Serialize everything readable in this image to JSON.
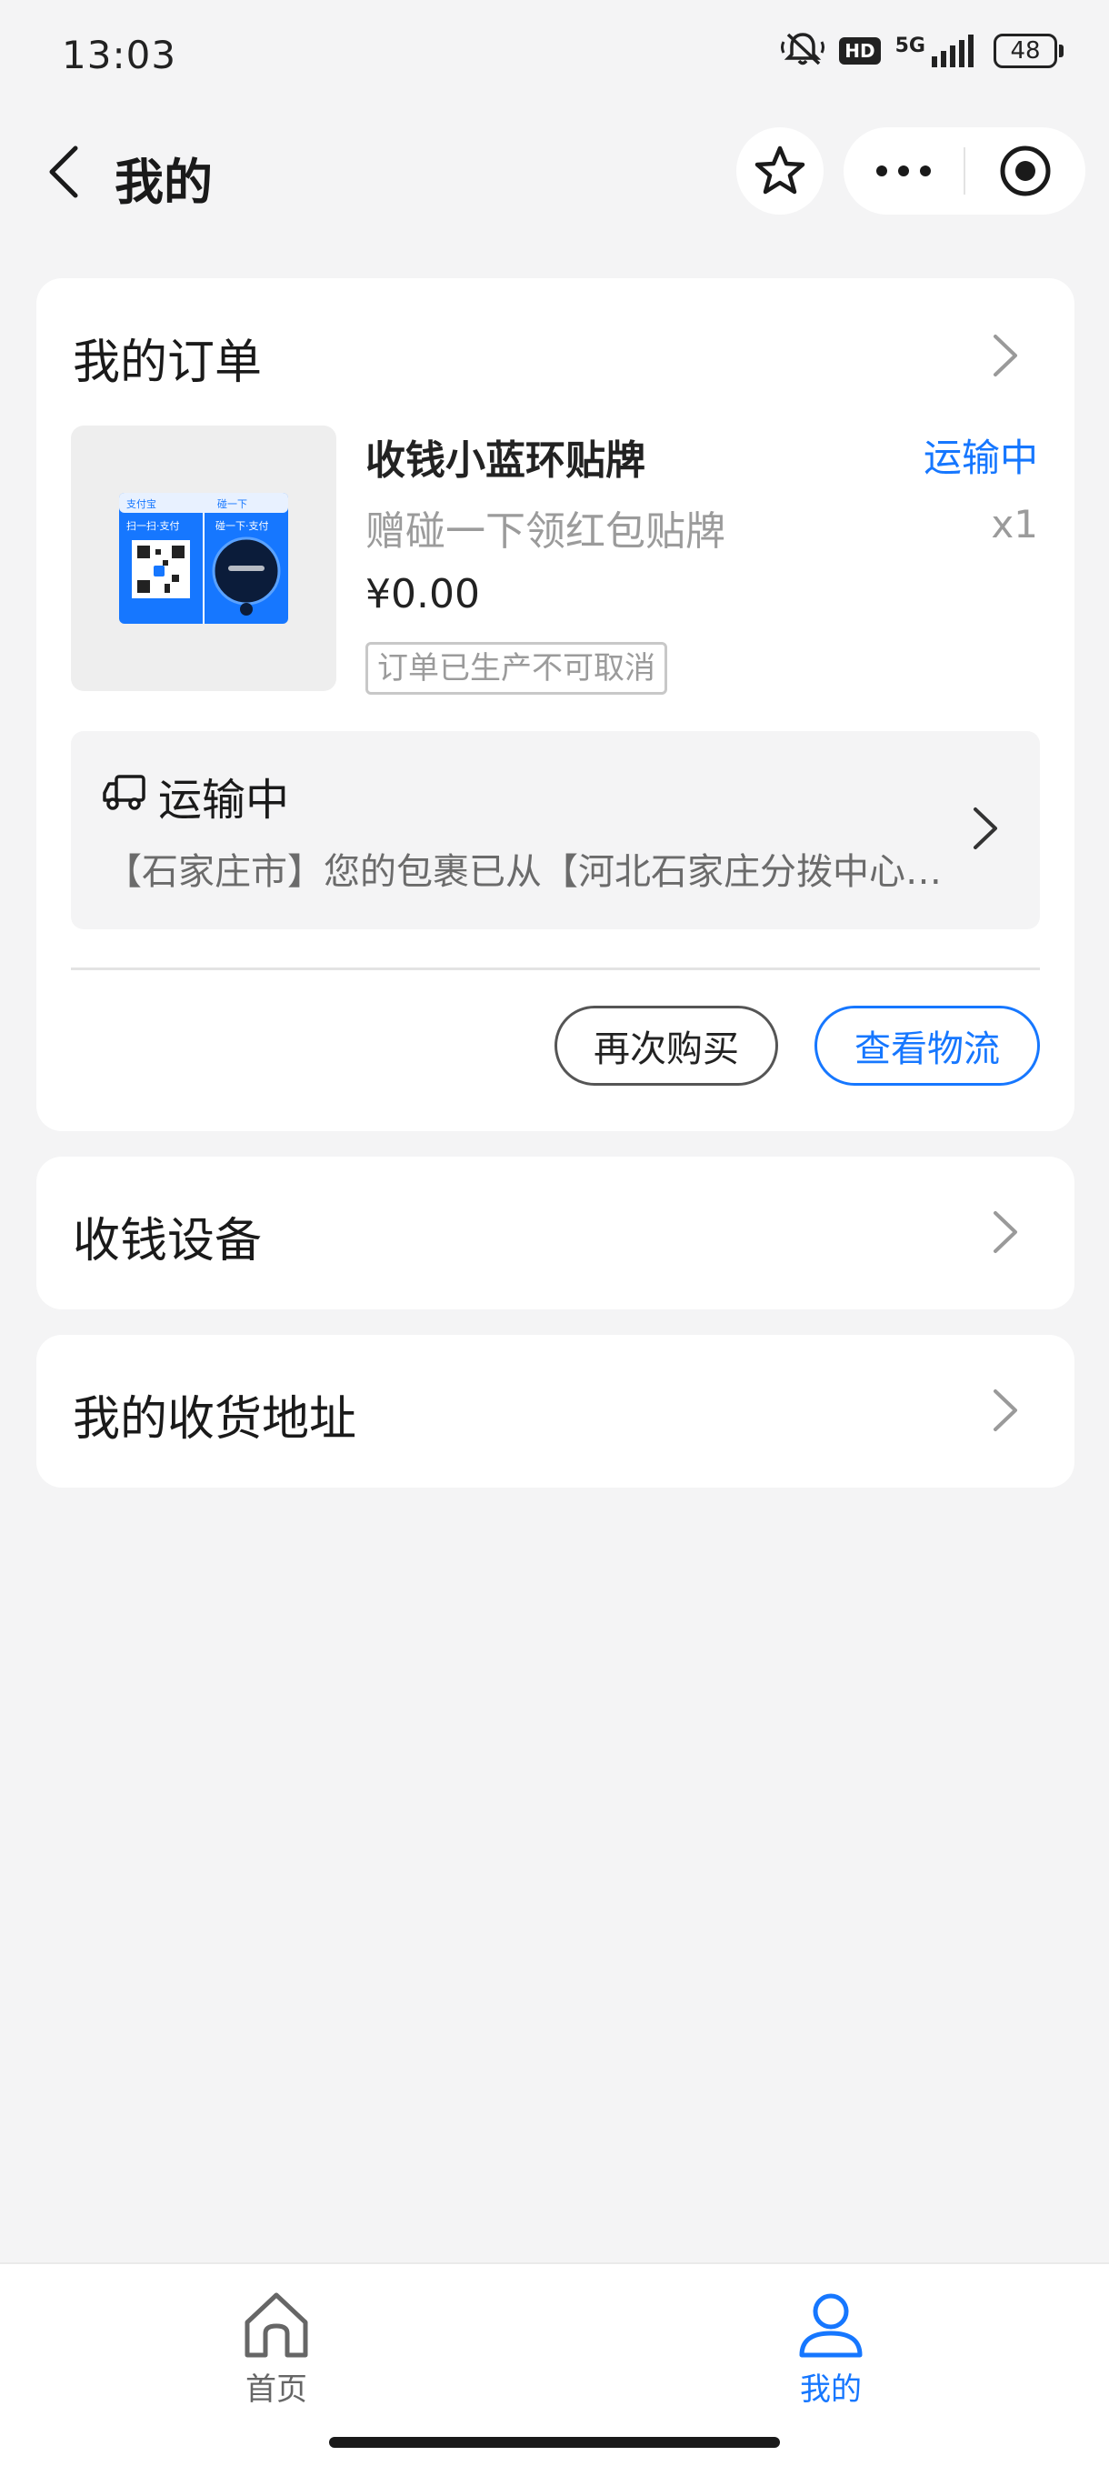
{
  "status_bar": {
    "time": "13:03",
    "hd": "HD",
    "network": "5G",
    "battery": "48",
    "icons": [
      "mute-icon",
      "signal-icon",
      "battery-icon"
    ]
  },
  "nav": {
    "title": "我的",
    "icons": [
      "back-icon",
      "star-icon",
      "more-icon",
      "close-target-icon"
    ]
  },
  "orders": {
    "header": "我的订单",
    "product": {
      "name": "收钱小蓝环贴牌",
      "subtitle": "赠碰一下领红包贴牌",
      "price": "¥0.00",
      "note": "订单已生产不可取消",
      "status": "运输中",
      "quantity": "x1",
      "image_labels": {
        "brand": "支付宝",
        "tap": "碰一下",
        "scan_pay": "扫一扫·支付",
        "tap_pay": "碰一下·支付"
      }
    },
    "shipping": {
      "title": "运输中",
      "detail": "【石家庄市】您的包裹已从【河北石家庄分拨中心】发出"
    },
    "buttons": {
      "rebuy": "再次购买",
      "logistics": "查看物流"
    }
  },
  "device": {
    "label": "收钱设备"
  },
  "address": {
    "label": "我的收货地址"
  },
  "tabbar": {
    "home": "首页",
    "mine": "我的",
    "active": "mine"
  },
  "colors": {
    "accent": "#1677ff",
    "background": "#f4f4f5",
    "card": "#ffffff"
  }
}
